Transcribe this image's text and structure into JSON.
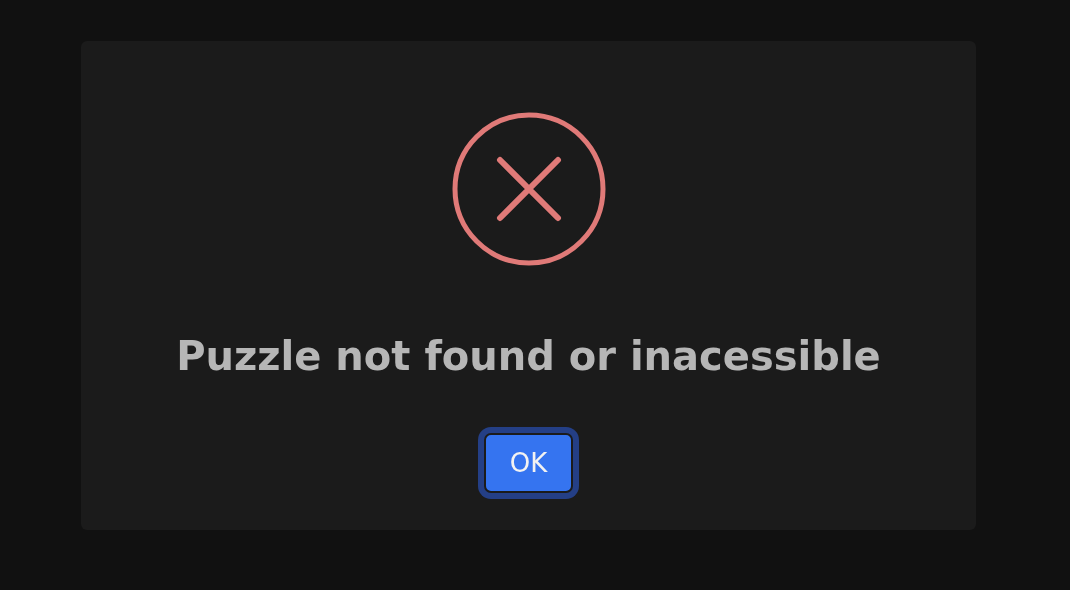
{
  "dialog": {
    "message": "Puzzle not found or inacessible",
    "button": {
      "label": "OK",
      "focused": true
    }
  }
}
